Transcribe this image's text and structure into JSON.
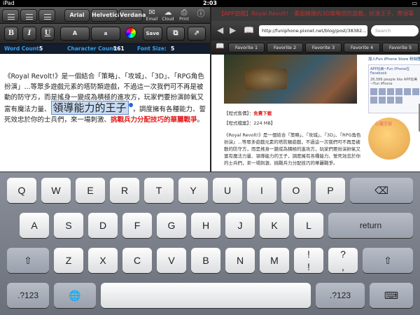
{
  "status": {
    "device": "iPad",
    "time": "2:03"
  },
  "editor": {
    "font_buttons": [
      "Arial",
      "Helvetica",
      "Verdana"
    ],
    "actions": [
      "Email",
      "Cloud",
      "Print"
    ],
    "format_buttons": [
      "B",
      "I",
      "U"
    ],
    "size_buttons": [
      "A",
      "a"
    ],
    "save_label": "Save",
    "stats": {
      "word_count_label": "Word Count:",
      "word_count": "5",
      "char_count_label": "Character Count:",
      "char_count": "161",
      "font_size_label": "Font Size:",
      "font_size": "5"
    },
    "doc": {
      "p1": "《Royal Revolt!》是一個結合「策略」、「攻城」、「3D」、「RPG角色扮演」...等眾多遊戲元素的塔防類遊戲，不過這一次我們可不再是被動的防守方，而是搖身一變成為積極的進攻方，玩家們要扮演帥氣又富有魔法力量、",
      "selected": "領導能力的王子",
      "p2": "，調度擁有各種能力、誓死效忠於你的士兵們，來一場刺激、",
      "red": "挑戰兵力分配技巧的華麗戰爭",
      "end": "。"
    }
  },
  "browser": {
    "title": "【APP遊戲】Royal Revolt! - 畫面精緻的3D策略塔防遊戲，扮演王子，帶領軍",
    "url": "http://funiphone.pixnet.net/blog/post/38382...",
    "search_placeholder": "Search",
    "favorites": [
      "Favorite 1",
      "Favorite 2",
      "Favorite 3",
      "Favorite 4",
      "Favorite 5"
    ],
    "price_label": "【程式售價】：",
    "price_value": "免費下載",
    "size_label": "【程式檔案】：224 MB】",
    "text": "《Royal Revolt!》是一個結合「策略」、「攻城」、「3D」、「RPG角色扮演」...等眾多遊戲元素的塔防類遊戲，不過這一次我們可不再是被動的防守方，而是搖身一變成為積極的進攻方，玩家們要扮演帥氣又富有魔法力量、領導能力的王子，調度擁有各種能力、誓死效忠於你的士兵們，來一場刺激、挑戰兵力分配技巧的華麗戰爭。",
    "side_header": "加入Fun iPhone Store 粉絲團",
    "side_fb_title": "APP玩美~Fun iPhone在Facebook",
    "side_fb_count": "26,586 people like APP玩美~Fun iPhone",
    "mascot_text": "心畫芝娛"
  },
  "keyboard": {
    "row1": [
      "Q",
      "W",
      "E",
      "R",
      "T",
      "Y",
      "U",
      "I",
      "O",
      "P"
    ],
    "row2": [
      "A",
      "S",
      "D",
      "F",
      "G",
      "H",
      "J",
      "K",
      "L"
    ],
    "row3": [
      "Z",
      "X",
      "C",
      "V",
      "B",
      "N",
      "M",
      "!",
      ","
    ],
    "return_label": "return",
    "row4": {
      "left": ".?123",
      "right": ".?123",
      "exclam_sub": "!",
      "comma_sub": ",",
      "question_sub": "?",
      "period_sub": "."
    }
  }
}
